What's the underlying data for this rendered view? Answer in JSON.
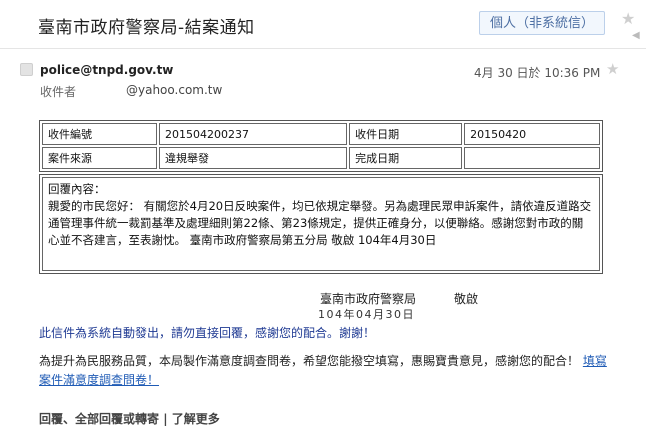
{
  "subject": {
    "title": "臺南市政府警察局-結案通知",
    "label_chip": "個人（非系統信）"
  },
  "message": {
    "sender": "police@tnpd.gov.tw",
    "recipient_label": "收件者",
    "recipient_value": "@yahoo.com.tw",
    "date": "4月 30 日於 10:36 PM"
  },
  "case_table": {
    "rows": [
      [
        "收件編號",
        "201504200237",
        "收件日期",
        "20150420"
      ],
      [
        "案件來源",
        "違規舉發",
        "完成日期",
        ""
      ]
    ]
  },
  "reply": {
    "title": "回覆內容：",
    "body": "親愛的市民您好： 有關您於4月20日反映案件，均已依規定舉發。另為處理民眾申訴案件，請依違反道路交通管理事件統一裁罰基準及處理細則第22條、第23條規定，提供正確身分，以便聯絡。感謝您對市政的關心並不吝建言，至表謝忱。 臺南市政府警察局第五分局 敬啟 104年4月30日"
  },
  "signature": {
    "org": "臺南市政府警察局",
    "closing": "敬啟",
    "date": "104年04月30日"
  },
  "notice": {
    "auto_sent": "此信件為系統自動發出，請勿直接回覆，感謝您的配合。謝謝！",
    "survey_text": "為提升為民服務品質，本局製作滿意度調查問卷，希望您能撥空填寫，惠賜寶貴意見，感謝您的配合！",
    "survey_link": "填寫案件滿意度調查問卷！"
  },
  "actions": {
    "reply_forward": "回覆、全部回覆或轉寄",
    "separator": "|",
    "learn_more": "了解更多"
  }
}
